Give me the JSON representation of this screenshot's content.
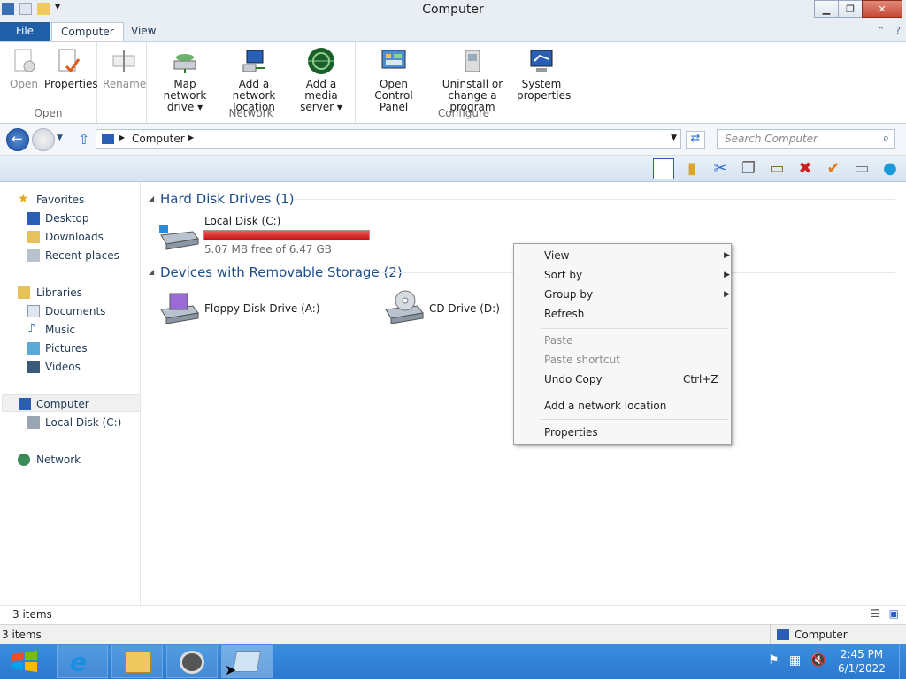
{
  "window": {
    "title": "Computer"
  },
  "tabs": {
    "file": "File",
    "computer": "Computer",
    "view": "View"
  },
  "ribbon": {
    "open_group": {
      "label": "Open",
      "open": "Open",
      "properties": "Properties",
      "rename": "Rename"
    },
    "network_group": {
      "label": "Network",
      "map_drive_1": "Map network",
      "map_drive_2": "drive ▾",
      "add_loc_1": "Add a network",
      "add_loc_2": "location",
      "add_media_1": "Add a media",
      "add_media_2": "server ▾"
    },
    "configure_group": {
      "label": "Configure",
      "control_1": "Open Control",
      "control_2": "Panel",
      "uninstall_1": "Uninstall or",
      "uninstall_2": "change a program",
      "system_1": "System",
      "system_2": "properties"
    }
  },
  "address": {
    "path": "Computer",
    "search_placeholder": "Search Computer"
  },
  "sidebar": {
    "favorites": "Favorites",
    "desktop": "Desktop",
    "downloads": "Downloads",
    "recent": "Recent places",
    "libraries": "Libraries",
    "documents": "Documents",
    "music": "Music",
    "pictures": "Pictures",
    "videos": "Videos",
    "computer": "Computer",
    "local_disk": "Local Disk (C:)",
    "network": "Network"
  },
  "main": {
    "hdd_header": "Hard Disk Drives (1)",
    "local_disk": {
      "name": "Local Disk (C:)",
      "free": "5.07 MB free of 6.47 GB",
      "used_fraction": 0.999
    },
    "removable_header": "Devices with Removable Storage (2)",
    "floppy": "Floppy Disk Drive (A:)",
    "cd": "CD Drive (D:)"
  },
  "context_menu": {
    "view": "View",
    "sort_by": "Sort by",
    "group_by": "Group by",
    "refresh": "Refresh",
    "paste": "Paste",
    "paste_shortcut": "Paste shortcut",
    "undo_copy": "Undo Copy",
    "undo_shortcut": "Ctrl+Z",
    "add_network": "Add a network location",
    "properties": "Properties"
  },
  "status": {
    "items_top": "3 items",
    "items_bottom": "3 items",
    "location": "Computer"
  },
  "clock": {
    "time": "2:45 PM",
    "date": "6/1/2022"
  }
}
